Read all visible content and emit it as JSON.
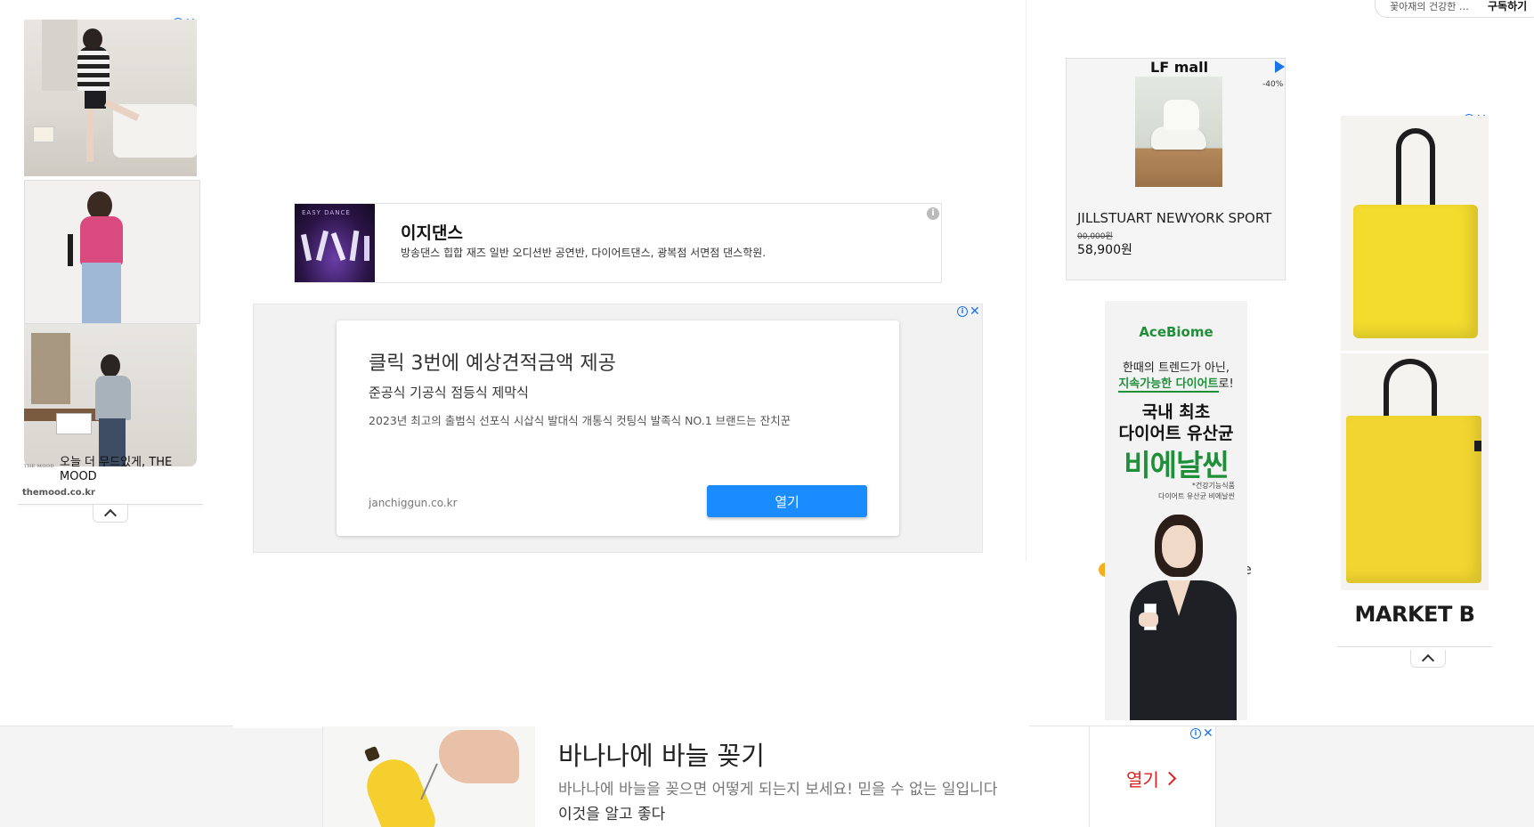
{
  "top_right": {
    "text": "꽃아재의 건강한 …",
    "subscribe": "구독하기"
  },
  "ad_left": {
    "brand_logo": "THE MOOD",
    "title": "오늘 더 무드있게, THE MOOD",
    "domain": "themood.co.kr"
  },
  "ad_dance": {
    "thumb_text": "EASY DANCE",
    "title": "이지댄스",
    "description": "방송댄스 힙합 재즈 일반 오디션반 공연반, 다이어트댄스, 광복점 서면점 댄스학원."
  },
  "ad_estimate": {
    "headline": "클릭 3번에 예상견적금액 제공",
    "subheadline": "준공식 기공식 점등식 제막식",
    "description": "2023년 최고의 출범식 선포식 시삽식 발대식 개통식 컷팅식 발족식 NO.1 브랜드는 잔치꾼",
    "domain": "janchiggun.co.kr",
    "button": "열기"
  },
  "ad_lfmall": {
    "logo": "LF mall",
    "discount": "-40%",
    "product": "JILLSTUART NEWYORK SPORT",
    "old_price": "00,000원",
    "price": "58,900원"
  },
  "ad_acebiome": {
    "brand": "AceBiome",
    "line1": "한때의 트렌드가 아닌,",
    "line2_highlight": "지속가능한 다이어트",
    "line2_suffix": "로!",
    "headline1": "국내 최초",
    "headline2": "다이어트 유산균",
    "product": "비에날씬",
    "note1": "*건강기능식품",
    "note2": "다이어트 유산균 비에날씬",
    "partial_text": "e"
  },
  "ad_marketb": {
    "brand": "MARKET B"
  },
  "ad_banana": {
    "title": "바나나에 바늘 꽂기",
    "line1": "바나나에 바늘을 꽂으면 어떻게 되는지 보세요! 믿을 수 없는 일입니다",
    "line2": "이것을 알고 좋다",
    "button": "열기"
  },
  "colors": {
    "accent_blue": "#1a8cff",
    "adchoice_blue": "#1a73e8",
    "green": "#1f8f3a",
    "red": "#e02020"
  }
}
